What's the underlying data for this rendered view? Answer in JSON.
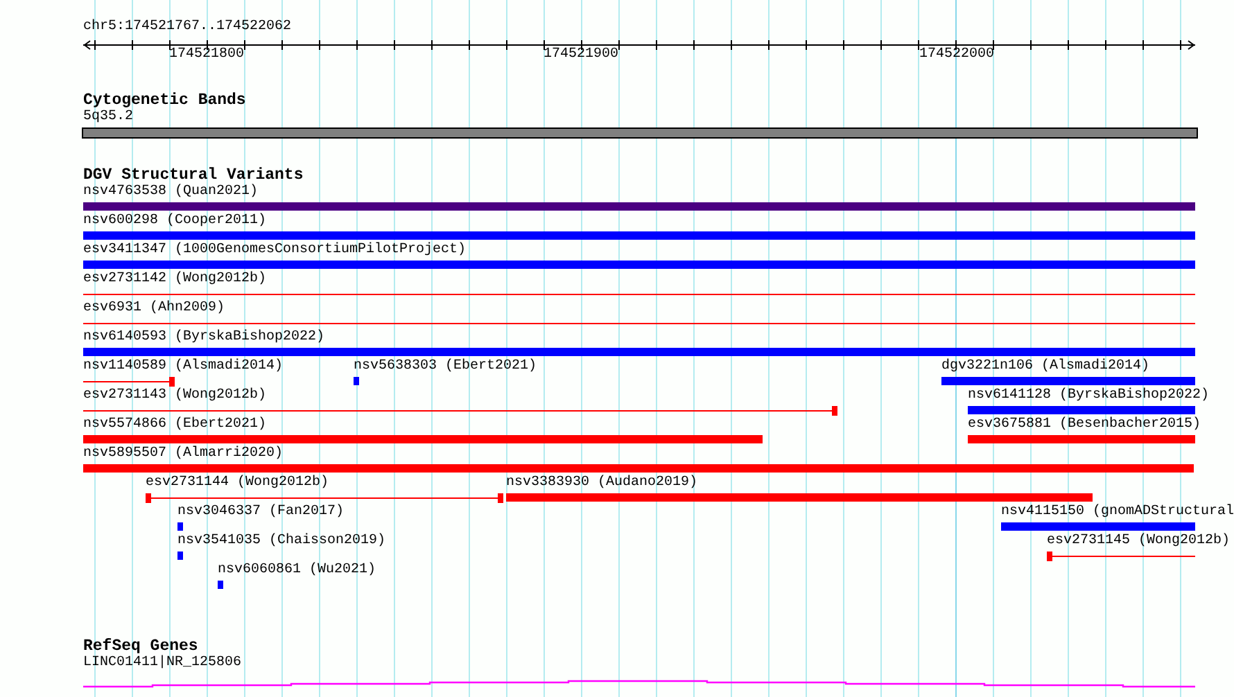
{
  "ruler": {
    "location": "chr5:174521767..174522062",
    "ticks": [
      "174521800",
      "174521900",
      "174522000"
    ]
  },
  "tracks": [
    {
      "title": "Cytogenetic Bands",
      "kind": "bands",
      "bands": [
        {
          "name": "5q35.2"
        }
      ]
    },
    {
      "title": "DGV Structural Variants",
      "kind": "features",
      "features": [
        {
          "label": "nsv4763538 (Quan2021)",
          "kind": "block",
          "color": "#4b0082"
        },
        {
          "label": "nsv600298 (Cooper2011)",
          "kind": "block",
          "color": "#0000ff"
        },
        {
          "label": "esv3411347 (1000GenomesConsortiumPilotProject)",
          "kind": "block",
          "color": "#0000ff"
        },
        {
          "label": "esv2731142 (Wong2012b)",
          "kind": "line",
          "color": "#ff0000",
          "cap_start": false,
          "cap_end": false
        },
        {
          "label": "esv6931 (Ahn2009)",
          "kind": "line",
          "color": "#ff0000",
          "cap_start": false,
          "cap_end": false
        },
        {
          "label": "nsv6140593 (ByrskaBishop2022)",
          "kind": "block",
          "color": "#0000ff"
        },
        {
          "label": "nsv1140589 (Alsmadi2014)",
          "kind": "line",
          "color": "#ff0000",
          "cap_start": false,
          "cap_end": true
        },
        {
          "label": "nsv5638303 (Ebert2021)",
          "kind": "block",
          "color": "#0000ff"
        },
        {
          "label": "dgv3221n106 (Alsmadi2014)",
          "kind": "block",
          "color": "#0000ff"
        },
        {
          "label": "esv2731143 (Wong2012b)",
          "kind": "line",
          "color": "#ff0000",
          "cap_start": false,
          "cap_end": true
        },
        {
          "label": "nsv6141128 (ByrskaBishop2022)",
          "kind": "block",
          "color": "#0000ff"
        },
        {
          "label": "nsv5574866 (Ebert2021)",
          "kind": "block",
          "color": "#ff0000"
        },
        {
          "label": "esv3675881 (Besenbacher2015)",
          "kind": "block",
          "color": "#ff0000"
        },
        {
          "label": "nsv5895507 (Almarri2020)",
          "kind": "block",
          "color": "#ff0000"
        },
        {
          "label": "esv2731144 (Wong2012b)",
          "kind": "line",
          "color": "#ff0000",
          "cap_start": true,
          "cap_end": true
        },
        {
          "label": "nsv3383930 (Audano2019)",
          "kind": "block",
          "color": "#ff0000"
        },
        {
          "label": "nsv3046337 (Fan2017)",
          "kind": "block",
          "color": "#0000ff"
        },
        {
          "label": "nsv4115150 (gnomADStructural",
          "kind": "block",
          "color": "#0000ff"
        },
        {
          "label": "nsv3541035 (Chaisson2019)",
          "kind": "block",
          "color": "#0000ff"
        },
        {
          "label": "esv2731145 (Wong2012b)",
          "kind": "line",
          "color": "#ff0000",
          "cap_start": true,
          "cap_end": false
        },
        {
          "label": "nsv6060861 (Wu2021)",
          "kind": "block",
          "color": "#0000ff"
        }
      ]
    },
    {
      "title": "RefSeq Genes",
      "kind": "genes",
      "genes": [
        {
          "name": "LINC01411|NR_125806"
        }
      ]
    }
  ]
}
